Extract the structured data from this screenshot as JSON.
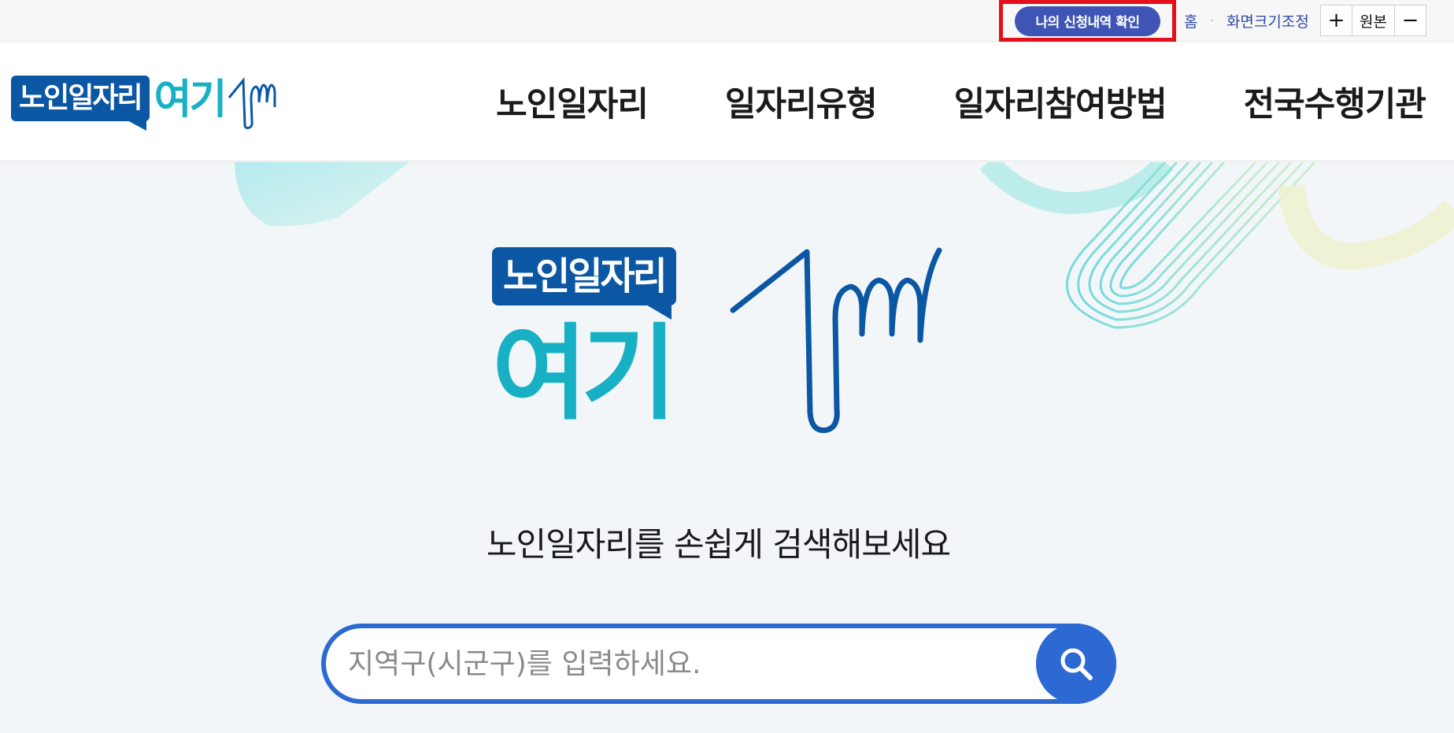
{
  "utility_bar": {
    "apply_check_label": "나의 신청내역 확인",
    "home_label": "홈",
    "separator": "·",
    "screen_size_label": "화면크기조정",
    "zoom_in_label": "+",
    "original_label": "원본",
    "zoom_out_label": "−"
  },
  "header": {
    "logo": {
      "bubble_text": "노인일자리",
      "main_text": "여기"
    },
    "nav": [
      {
        "label": "노인일자리"
      },
      {
        "label": "일자리유형"
      },
      {
        "label": "일자리참여방법"
      },
      {
        "label": "전국수행기관"
      }
    ]
  },
  "hero": {
    "logo": {
      "bubble_text": "노인일자리",
      "main_text": "여기"
    },
    "tagline": "노인일자리를 손쉽게 검색해보세요",
    "search": {
      "placeholder": "지역구(시군구)를 입력하세요."
    }
  },
  "colors": {
    "primary_blue": "#2c69d3",
    "logo_navy": "#0b57a4",
    "logo_teal": "#18b0c4",
    "button_indigo": "#3f55b5",
    "highlight_red": "#e3101b"
  },
  "icons": {
    "search_button": "search-icon",
    "logo_mark": "pointing-finger-icon"
  }
}
